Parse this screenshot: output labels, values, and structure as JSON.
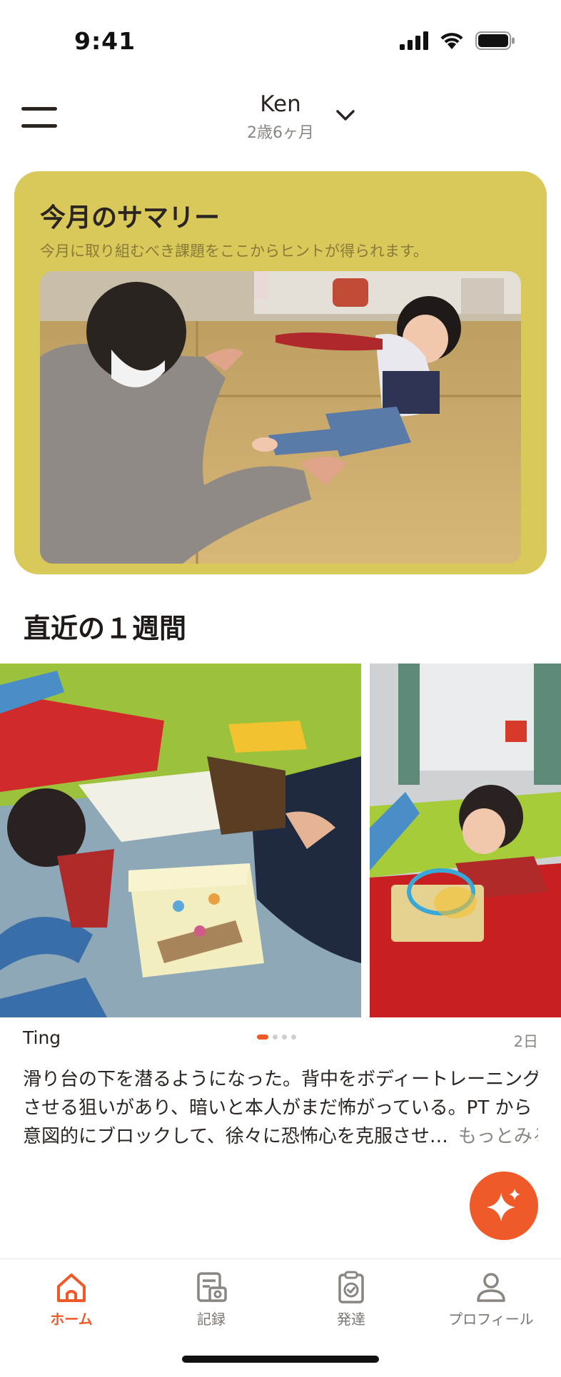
{
  "status_bar": {
    "time": "9:41",
    "icons": [
      "signal-icon",
      "wifi-icon",
      "battery-icon"
    ]
  },
  "header": {
    "child_name": "Ken",
    "child_age": "2歳6ヶ月",
    "menu_icon": "menu-icon",
    "dropdown_icon": "chevron-down-icon"
  },
  "summary": {
    "title": "今月のサマリー",
    "subtitle": "今月に取り組むべき課題をここからヒントが得られます。",
    "background_color": "#d8c95a"
  },
  "recent": {
    "section_title": "直近の１週間",
    "post": {
      "author": "Ting",
      "date": "2日",
      "body_lines": [
        "滑り台の下を潜るようになった。背中をボディートレーニング",
        "させる狙いがあり、暗いと本人がまだ怖がっている。PT から",
        "意図的にブロックして、徐々に恐怖心を克服させ…"
      ],
      "more_label": "もっとみる",
      "page_indicator": {
        "count": 4,
        "active_index": 0
      }
    }
  },
  "fab": {
    "icon": "sparkle-icon"
  },
  "tab_bar": {
    "accent_color": "#f05a28",
    "tabs": [
      {
        "label": "ホーム",
        "icon": "home-icon",
        "active": true
      },
      {
        "label": "記録",
        "icon": "record-photo-icon",
        "active": false
      },
      {
        "label": "発達",
        "icon": "clipboard-check-icon",
        "active": false
      },
      {
        "label": "プロフィール",
        "icon": "profile-icon",
        "active": false
      }
    ]
  }
}
